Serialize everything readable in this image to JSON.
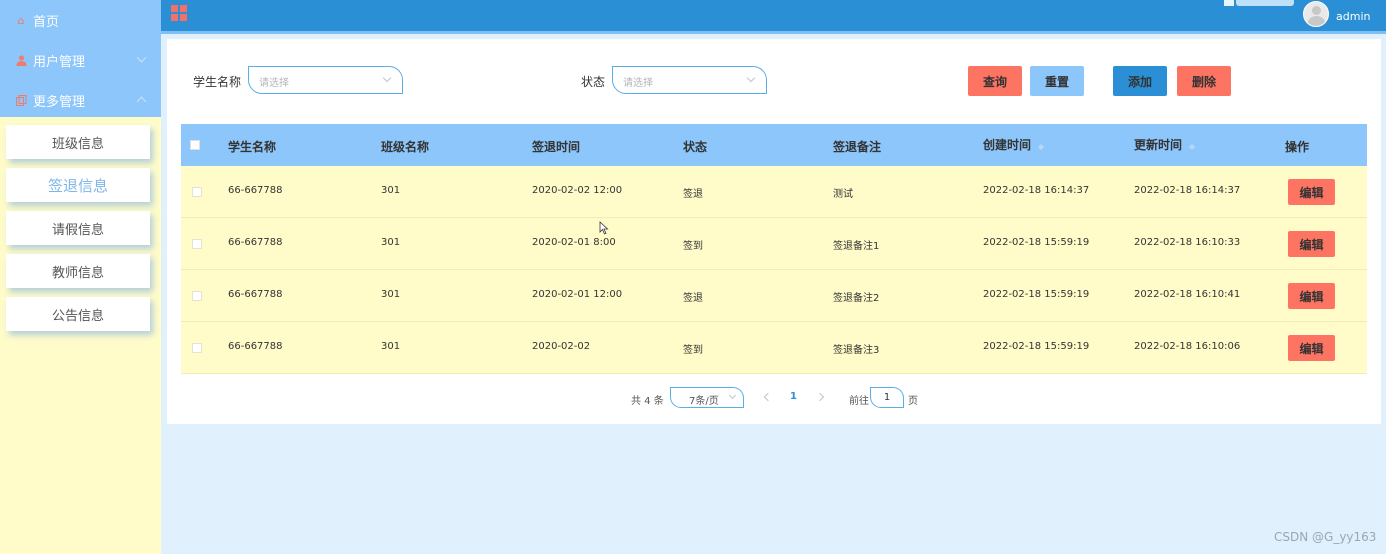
{
  "sidebar": {
    "menus": [
      {
        "label": "首页",
        "icon": "home-icon"
      },
      {
        "label": "用户管理",
        "icon": "user-icon"
      },
      {
        "label": "更多管理",
        "icon": "copy-icon"
      }
    ],
    "sub_items": [
      {
        "label": "班级信息",
        "active": false
      },
      {
        "label": "签退信息",
        "active": true
      },
      {
        "label": "请假信息",
        "active": false
      },
      {
        "label": "教师信息",
        "active": false
      },
      {
        "label": "公告信息",
        "active": false
      }
    ]
  },
  "topbar": {
    "username": "admin"
  },
  "filters": {
    "student_label": "学生名称",
    "student_placeholder": "请选择",
    "status_label": "状态",
    "status_placeholder": "请选择"
  },
  "actions": {
    "query": "查询",
    "reset": "重置",
    "add": "添加",
    "delete": "删除"
  },
  "table": {
    "headers": [
      "学生名称",
      "班级名称",
      "签退时间",
      "状态",
      "签退备注",
      "创建时间",
      "更新时间",
      "操作"
    ],
    "edit_label": "编辑",
    "rows": [
      {
        "student": "66-667788",
        "class": "301",
        "time": "2020-02-02 12:00",
        "status": "签退",
        "note": "测试",
        "created": "2022-02-18 16:14:37",
        "updated": "2022-02-18 16:14:37"
      },
      {
        "student": "66-667788",
        "class": "301",
        "time": "2020-02-01 8:00",
        "status": "签到",
        "note": "签退备注1",
        "created": "2022-02-18 15:59:19",
        "updated": "2022-02-18 16:10:33"
      },
      {
        "student": "66-667788",
        "class": "301",
        "time": "2020-02-01 12:00",
        "status": "签退",
        "note": "签退备注2",
        "created": "2022-02-18 15:59:19",
        "updated": "2022-02-18 16:10:41"
      },
      {
        "student": "66-667788",
        "class": "301",
        "time": "2020-02-02",
        "status": "签到",
        "note": "签退备注3",
        "created": "2022-02-18 15:59:19",
        "updated": "2022-02-18 16:10:06"
      }
    ]
  },
  "pagination": {
    "total": "共 4 条",
    "page_size": "7条/页",
    "current": "1",
    "goto_label": "前往",
    "goto_value": "1",
    "page_suffix": "页"
  },
  "watermark": "CSDN @G_yy163",
  "colors": {
    "topbar": "#2a8fd4",
    "sidebar_top": "#8cc6fb",
    "sidebar_bg": "#fffcc9",
    "header_bg": "#8cc6fb",
    "row_bg": "#fffcc9",
    "danger": "#fd7462"
  }
}
